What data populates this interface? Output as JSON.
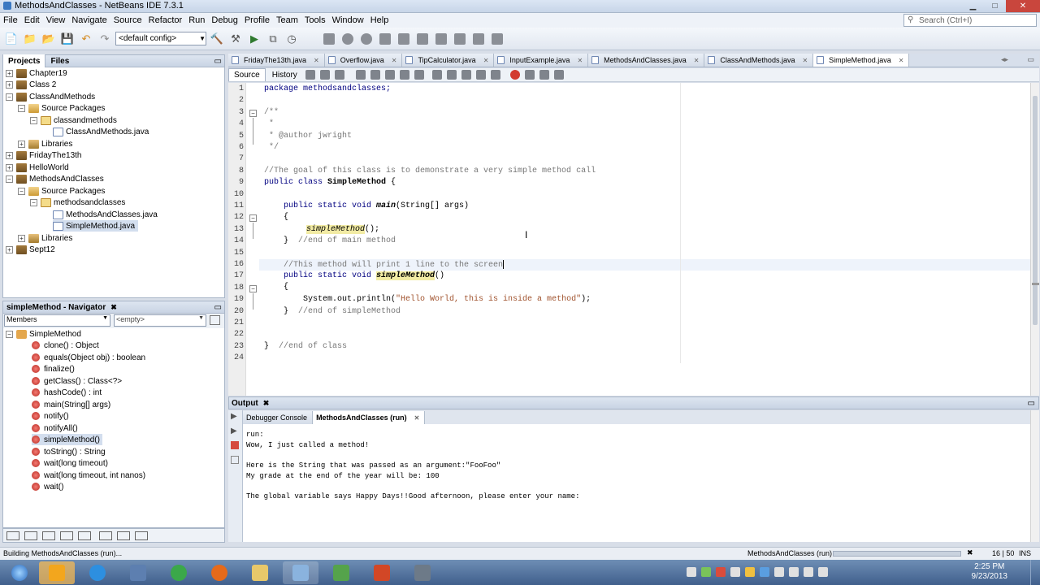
{
  "window": {
    "title": "MethodsAndClasses - NetBeans IDE 7.3.1"
  },
  "menu": [
    "File",
    "Edit",
    "View",
    "Navigate",
    "Source",
    "Refactor",
    "Run",
    "Debug",
    "Profile",
    "Team",
    "Tools",
    "Window",
    "Help"
  ],
  "search": {
    "placeholder": "Search (Ctrl+I)"
  },
  "toolbar": {
    "config": "<default config>"
  },
  "projects_panel": {
    "tabs": [
      "Projects",
      "Files"
    ],
    "tree": [
      {
        "label": "Chapter19",
        "icon": "project-icon"
      },
      {
        "label": "Class 2",
        "icon": "project-icon"
      },
      {
        "label": "ClassAndMethods",
        "icon": "project-icon"
      },
      {
        "label": "Source Packages",
        "icon": "source-packages-icon"
      },
      {
        "label": "classandmethods",
        "icon": "package-icon"
      },
      {
        "label": "ClassAndMethods.java",
        "icon": "java-file-icon"
      },
      {
        "label": "Libraries",
        "icon": "libraries-icon"
      },
      {
        "label": "FridayThe13th",
        "icon": "project-icon"
      },
      {
        "label": "HelloWorld",
        "icon": "project-icon"
      },
      {
        "label": "MethodsAndClasses",
        "icon": "project-icon"
      },
      {
        "label": "Source Packages",
        "icon": "source-packages-icon"
      },
      {
        "label": "methodsandclasses",
        "icon": "package-icon"
      },
      {
        "label": "MethodsAndClasses.java",
        "icon": "java-file-icon"
      },
      {
        "label": "SimpleMethod.java",
        "icon": "java-file-icon"
      },
      {
        "label": "Libraries",
        "icon": "libraries-icon"
      },
      {
        "label": "Sept12",
        "icon": "project-icon"
      }
    ]
  },
  "navigator": {
    "title": "simpleMethod - Navigator",
    "filter": "Members",
    "empty": "<empty>",
    "root": "SimpleMethod",
    "members": [
      "clone() : Object",
      "equals(Object obj) : boolean",
      "finalize()",
      "getClass() : Class<?>",
      "hashCode() : int",
      "main(String[] args)",
      "notify()",
      "notifyAll()",
      "simpleMethod()",
      "toString() : String",
      "wait(long timeout)",
      "wait(long timeout, int nanos)",
      "wait()"
    ]
  },
  "editor": {
    "tabs": [
      "FridayThe13th.java",
      "Overflow.java",
      "TipCalculator.java",
      "InputExample.java",
      "MethodsAndClasses.java",
      "ClassAndMethods.java",
      "SimpleMethod.java"
    ],
    "active_tab": "SimpleMethod.java",
    "view_tabs": [
      "Source",
      "History"
    ],
    "lines": {
      "l1": "package methodsandclasses;",
      "l3": "/**",
      "l4": " *",
      "l5": " * @author jwright",
      "l6": " */",
      "l8": "//The goal of this class is to demonstrate a very simple method call",
      "l9a": "public class ",
      "l9b": "SimpleMethod",
      " l9c": " {",
      "l11a": "    public static void ",
      "l11b": "main",
      "l11c": "(String[] args)",
      "l12": "    {",
      "l13a": "simpleMethod",
      "l13b": "();",
      "l14a": "    }  ",
      "l14b": "//end of main method",
      "l16": "    //This method will print 1 line to the screen",
      "l17a": "    public static void ",
      "l17b": "simpleMethod",
      "l17c": "()",
      "l18": "    {",
      "l19a": "        System.out.println(",
      "l19b": "\"Hello World, this is inside a method\"",
      "l19c": ");",
      "l20a": "    }  ",
      "l20b": "//end of simpleMethod",
      "l23a": "}  ",
      "l23b": "//end of class"
    },
    "line_numbers": [
      "1",
      "2",
      "3",
      "4",
      "5",
      "6",
      "7",
      "8",
      "9",
      "10",
      "11",
      "12",
      "13",
      "14",
      "15",
      "16",
      "17",
      "18",
      "19",
      "20",
      "21",
      "22",
      "23",
      "24"
    ]
  },
  "output": {
    "title": "Output",
    "tabs": [
      "Debugger Console",
      "MethodsAndClasses (run)"
    ],
    "lines": [
      "run:",
      "Wow, I just called a method!",
      "",
      "Here is the String that was passed as an argument:\"FooFoo\"",
      "My grade at the end of the year will be: 100",
      "",
      "The global variable says Happy Days!!Good afternoon, please enter your name:"
    ]
  },
  "status": {
    "left": "Building MethodsAndClasses (run)...",
    "task": "MethodsAndClasses (run)",
    "position": "16 | 50",
    "mode": "INS"
  },
  "clock": {
    "time": "2:25 PM",
    "date": "9/23/2013"
  }
}
